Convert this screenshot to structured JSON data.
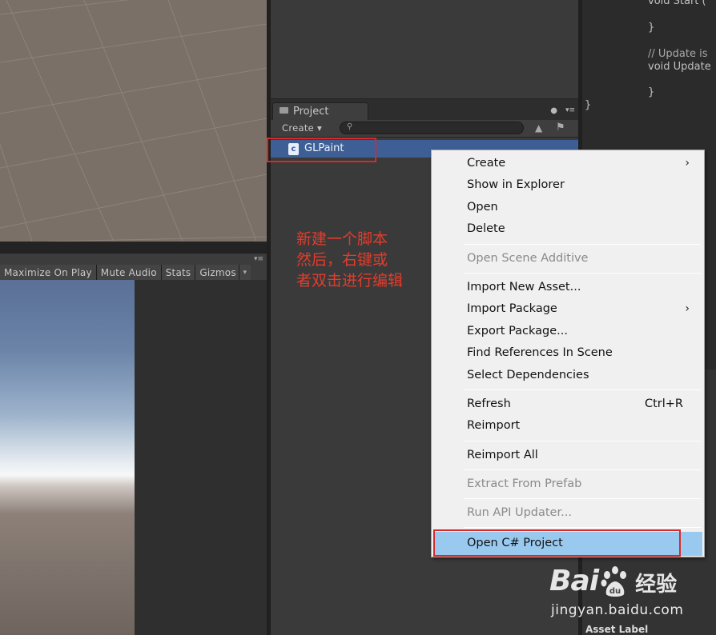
{
  "game_toolbar": {
    "buttons": [
      "Maximize On Play",
      "Mute Audio",
      "Stats",
      "Gizmos"
    ],
    "menu_glyph": "▾≡",
    "gizmos_arrow": "▾"
  },
  "project_panel": {
    "tab_label": "Project",
    "create_label": "Create ▾",
    "search_placeholder": "",
    "selected_asset": "GLPaint",
    "lock_glyph": "🔒",
    "menu_glyph": "▾≡"
  },
  "annotation": {
    "lines": [
      "新建一个脚本",
      "然后，右键或",
      "者双击进行编辑"
    ],
    "color": "#e23c2c"
  },
  "code_editor": {
    "lines": [
      {
        "text": "void Start (",
        "indent": 1
      },
      {
        "text": "}",
        "indent": 1
      },
      {
        "text": "// Update is",
        "indent": 1,
        "comment": true
      },
      {
        "text": "void Update",
        "indent": 1
      },
      {
        "text": "}",
        "indent": 1
      },
      {
        "text": "}",
        "indent": 0
      }
    ],
    "bottom_text": "Asset Label"
  },
  "context_menu": {
    "items": [
      {
        "label": "Create",
        "submenu": true
      },
      {
        "label": "Show in Explorer"
      },
      {
        "label": "Open"
      },
      {
        "label": "Delete"
      },
      {
        "label": "Open Scene Additive",
        "disabled": true
      },
      {
        "label": "Import New Asset..."
      },
      {
        "label": "Import Package",
        "submenu": true
      },
      {
        "label": "Export Package..."
      },
      {
        "label": "Find References In Scene"
      },
      {
        "label": "Select Dependencies"
      },
      {
        "label": "Refresh",
        "shortcut": "Ctrl+R"
      },
      {
        "label": "Reimport"
      },
      {
        "label": "Reimport All"
      },
      {
        "label": "Extract From Prefab",
        "disabled": true
      },
      {
        "label": "Run API Updater...",
        "disabled": true
      },
      {
        "label": "Open C# Project",
        "highlighted": true
      }
    ],
    "highlight_color": "#99c9ef"
  },
  "watermark": {
    "brand": "Bai",
    "brand_suffix": "经验",
    "url": "jingyan.baidu.com"
  }
}
